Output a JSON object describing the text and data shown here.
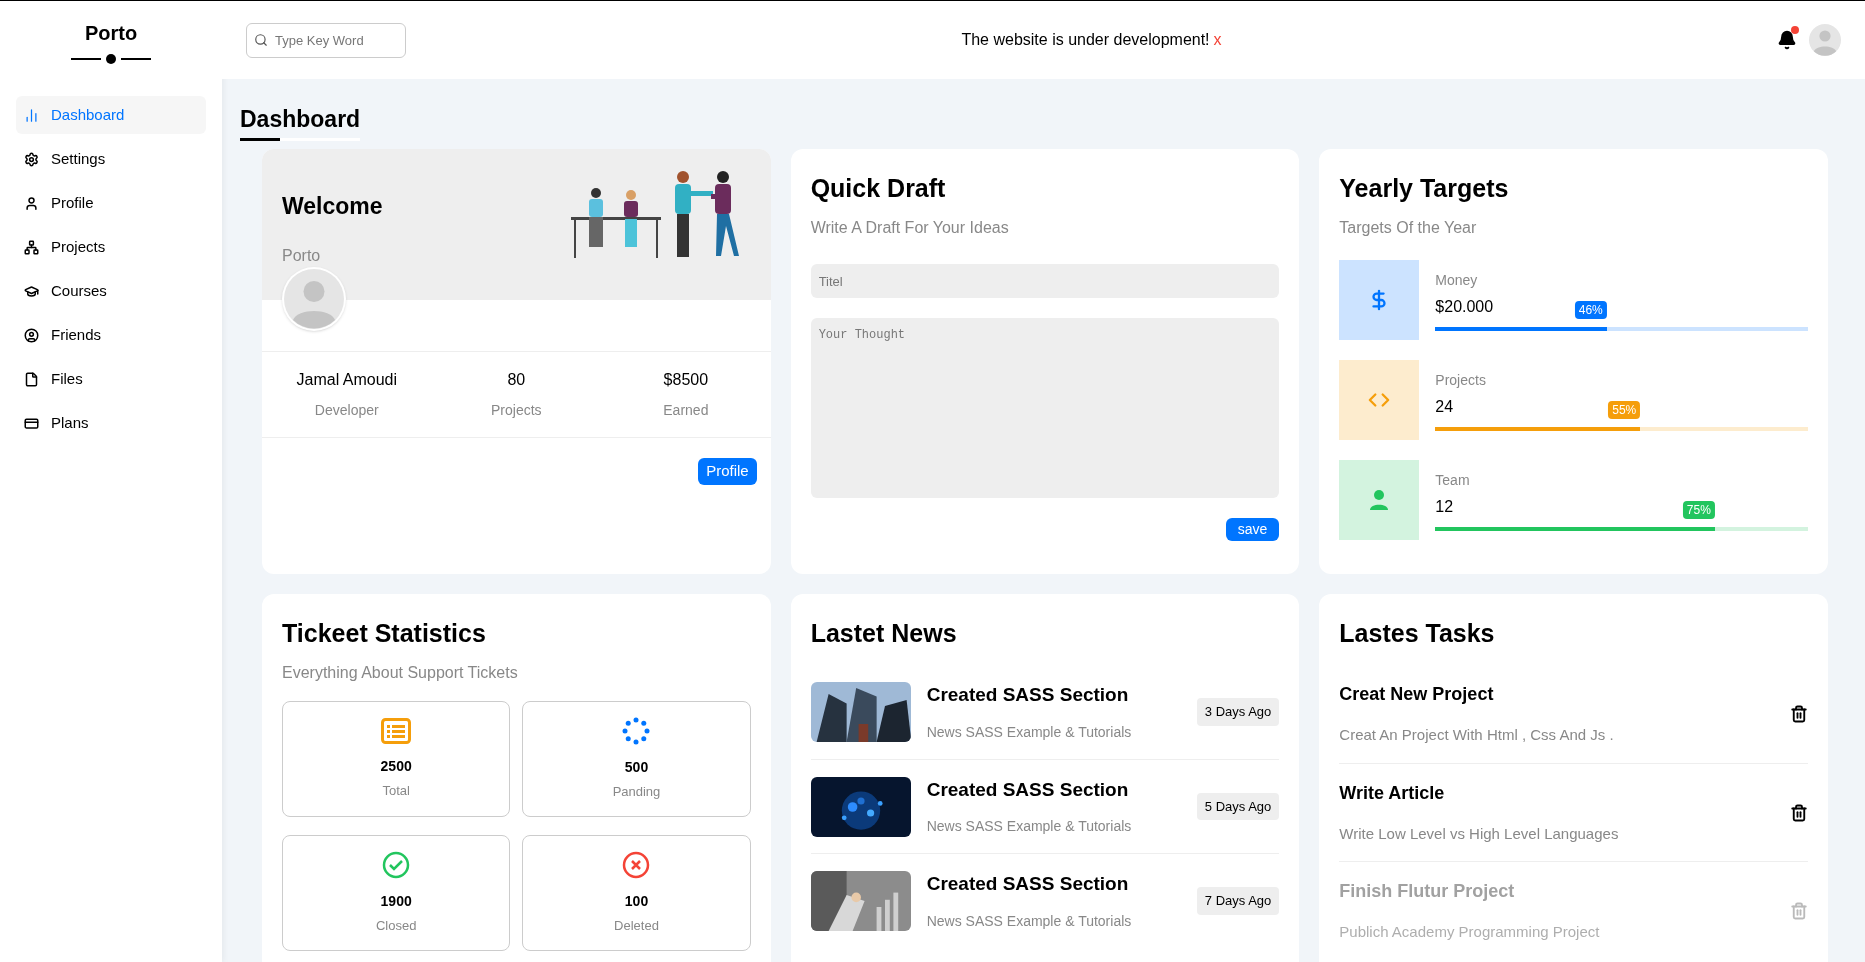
{
  "sidebar": {
    "brand": "Porto",
    "items": [
      {
        "label": "Dashboard",
        "selected": true
      },
      {
        "label": "Settings",
        "selected": false
      },
      {
        "label": "Profile",
        "selected": false
      },
      {
        "label": "Projects",
        "selected": false
      },
      {
        "label": "Courses",
        "selected": false
      },
      {
        "label": "Friends",
        "selected": false
      },
      {
        "label": "Files",
        "selected": false
      },
      {
        "label": "Plans",
        "selected": false
      }
    ]
  },
  "header": {
    "search": {
      "placeholder": "Type Key Word"
    },
    "notice": "The website is under development!",
    "notice_close": "x",
    "notifications": {
      "unread": true
    }
  },
  "page_title": "Dashboard",
  "welcome": {
    "title": "Welcome",
    "subtitle": "Porto",
    "stats": [
      {
        "value": "Jamal Amoudi",
        "label": "Developer"
      },
      {
        "value": "80",
        "label": "Projects"
      },
      {
        "value": "$8500",
        "label": "Earned"
      }
    ],
    "button": "Profile"
  },
  "quick_draft": {
    "title": "Quick Draft",
    "subtitle": "Write A Draft For Your Ideas",
    "title_field": {
      "placeholder": "Titel"
    },
    "body_field": {
      "placeholder": "Your Thought"
    },
    "button": "save"
  },
  "yearly_targets": {
    "title": "Yearly Targets",
    "subtitle": "Targets Of the Year",
    "targets": [
      {
        "kind": "money",
        "label": "Money",
        "value": "$20.000",
        "percent": "46%",
        "level": 0.46,
        "color": "#0075ff"
      },
      {
        "kind": "code",
        "label": "Projects",
        "value": "24",
        "percent": "55%",
        "level": 0.55,
        "color": "#f59e0b"
      },
      {
        "kind": "team",
        "label": "Team",
        "value": "12",
        "percent": "75%",
        "level": 0.75,
        "color": "#22c55e"
      }
    ]
  },
  "tickets": {
    "title": "Tickeet Statistics",
    "subtitle": "Everything About Support Tickets",
    "items": [
      {
        "kind": "list",
        "value": "2500",
        "label": "Total",
        "color": "#f59e0b"
      },
      {
        "kind": "spinner",
        "value": "500",
        "label": "Panding",
        "color": "#0075ff"
      },
      {
        "kind": "check",
        "value": "1900",
        "label": "Closed",
        "color": "#22c55e"
      },
      {
        "kind": "cross",
        "value": "100",
        "label": "Deleted",
        "color": "#f44336"
      }
    ]
  },
  "news": {
    "title": "Lastet News",
    "items": [
      {
        "kind": "picture",
        "title": "Created SASS Section",
        "text": "News SASS Example & Tutorials",
        "date": "3 Days Ago"
      },
      {
        "kind": "picture",
        "title": "Created SASS Section",
        "text": "News SASS Example & Tutorials",
        "date": "5 Days Ago"
      },
      {
        "kind": "picture",
        "title": "Created SASS Section",
        "text": "News SASS Example & Tutorials",
        "date": "7 Days Ago"
      }
    ]
  },
  "tasks": {
    "title": "Lastes Tasks",
    "items": [
      {
        "title": "Creat New Project",
        "text": "Creat An Project With Html , Css And Js .",
        "done": false
      },
      {
        "title": "Write Article",
        "text": "Write Low Level vs High Level Languages",
        "done": false
      },
      {
        "title": "Finish Flutur Project",
        "text": "Publich Academy Programming Project",
        "done": true
      }
    ]
  }
}
